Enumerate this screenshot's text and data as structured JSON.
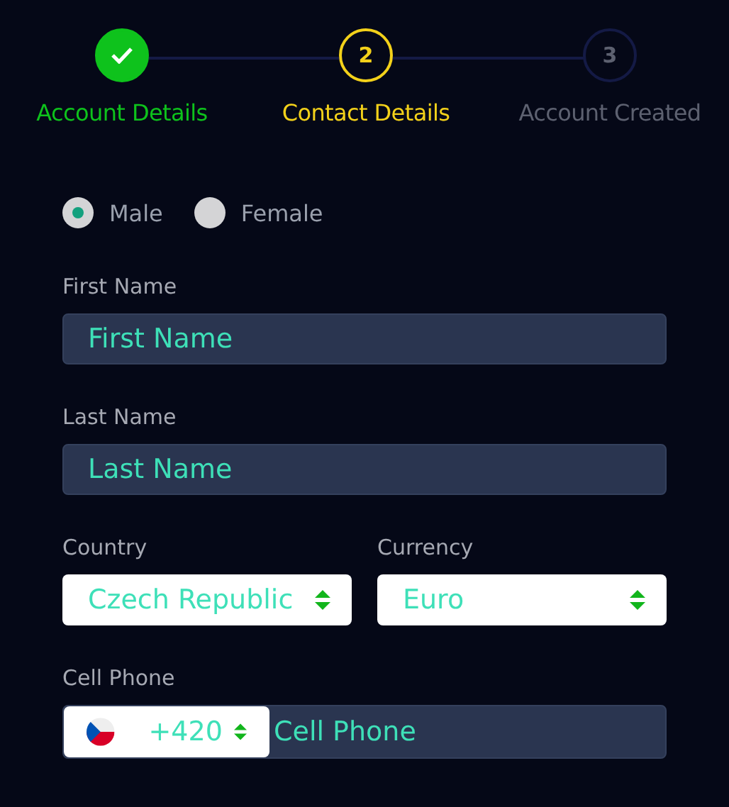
{
  "steps": [
    {
      "label": "Account Details",
      "kind": "done"
    },
    {
      "label": "Contact Details",
      "number": "2",
      "kind": "active"
    },
    {
      "label": "Account Created",
      "number": "3",
      "kind": "pending"
    }
  ],
  "gender": [
    {
      "label": "Male",
      "selected": true
    },
    {
      "label": "Female",
      "selected": false
    }
  ],
  "first_name": {
    "label": "First Name",
    "placeholder": "First Name"
  },
  "last_name": {
    "label": "Last Name",
    "placeholder": "Last Name"
  },
  "country": {
    "label": "Country",
    "value": "Czech Republic"
  },
  "currency": {
    "label": "Currency",
    "value": "Euro"
  },
  "cell_phone": {
    "label": "Cell Phone",
    "code": "+420",
    "placeholder": "Cell Phone"
  }
}
